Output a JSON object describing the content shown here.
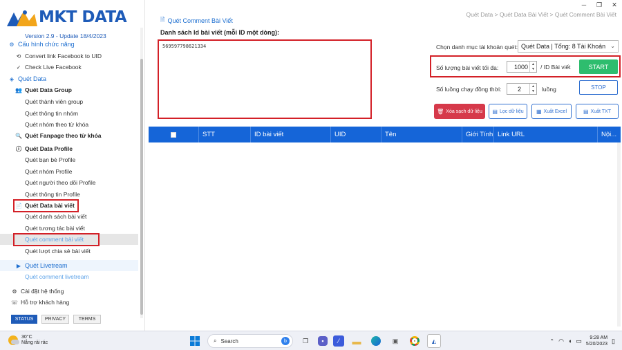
{
  "app": {
    "logo_text": "MKT DATA",
    "version": "Version 2.9 - Update 18/4/2023",
    "window_controls": [
      "─",
      "❐",
      "✕"
    ]
  },
  "sidebar": {
    "sections": [
      {
        "key": "config",
        "label": "Cấu hình chức năng",
        "icon": "gear-icon"
      },
      {
        "key": "data",
        "label": "Quét Data",
        "icon": "database-icon"
      },
      {
        "key": "livestream",
        "label": "Quét Livetream",
        "icon": "video-icon"
      }
    ],
    "items": {
      "convert_uid": "Convert link Facebook to UID",
      "check_live": "Check Live Facebook",
      "group": "Quét Data Group",
      "group_members": "Quét thành viên group",
      "group_info": "Quét thông tin nhóm",
      "group_by_keyword": "Quét nhóm theo từ khóa",
      "fanpage_keyword": "Quét Fanpage theo từ khóa",
      "profile": "Quét Data Profile",
      "profile_friends": "Quét bạn bè Profile",
      "profile_groups": "Quét nhóm Profile",
      "profile_followers": "Quét người theo dõi Profile",
      "profile_info": "Quét thông tin Profile",
      "post": "Quét Data bài viết",
      "post_list": "Quét danh sách bài viết",
      "post_interactions": "Quét tương tác bài viết",
      "post_comments": "Quét comment bài viết",
      "post_shares": "Quét lượt chia sẻ bài viết",
      "live_comments": "Quét comment livetream",
      "settings": "Cài đặt hệ thống",
      "support": "Hỗ trợ khách hàng"
    },
    "footer": {
      "status": "STATUS",
      "privacy": "PRIVACY",
      "terms": "TERMS"
    }
  },
  "main": {
    "page_title": "Quét Comment Bài Viết",
    "breadcrumb": "Quét Data > Quét Data Bài Viết > Quét Comment Bài Viết",
    "id_list_label": "Danh sách Id bài viết (mỗi ID một dòng):",
    "id_list_value": "569597798621334",
    "account_label": "Chọn danh mục tài khoản quét:",
    "account_value": "Quét Data | Tổng: 8 Tài Khoản",
    "max_posts_label": "Số lượng bài viết tối đa:",
    "max_posts_value": "1000",
    "max_posts_unit": "/ ID Bài viết",
    "threads_label": "Số luồng chạy đồng thời:",
    "threads_value": "2",
    "threads_unit": "luồng",
    "start": "START",
    "stop": "STOP",
    "clear": "Xóa sạch dữ liệu",
    "filter": "Lọc dữ liệu",
    "export_excel": "Xuất Excel",
    "export_txt": "Xuất TXT",
    "columns": [
      "STT",
      "ID bài viết",
      "UID",
      "Tên",
      "Giới Tính",
      "Link URL",
      "Nội..."
    ]
  },
  "taskbar": {
    "temperature": "30°C",
    "weather": "Nắng rải rác",
    "search": "Search",
    "time": "9:28 AM",
    "date": "5/20/2023"
  },
  "colors": {
    "accent": "#1565d8",
    "start": "#2ebd6e",
    "danger": "#d6394a",
    "highlight_border": "#d32027"
  }
}
